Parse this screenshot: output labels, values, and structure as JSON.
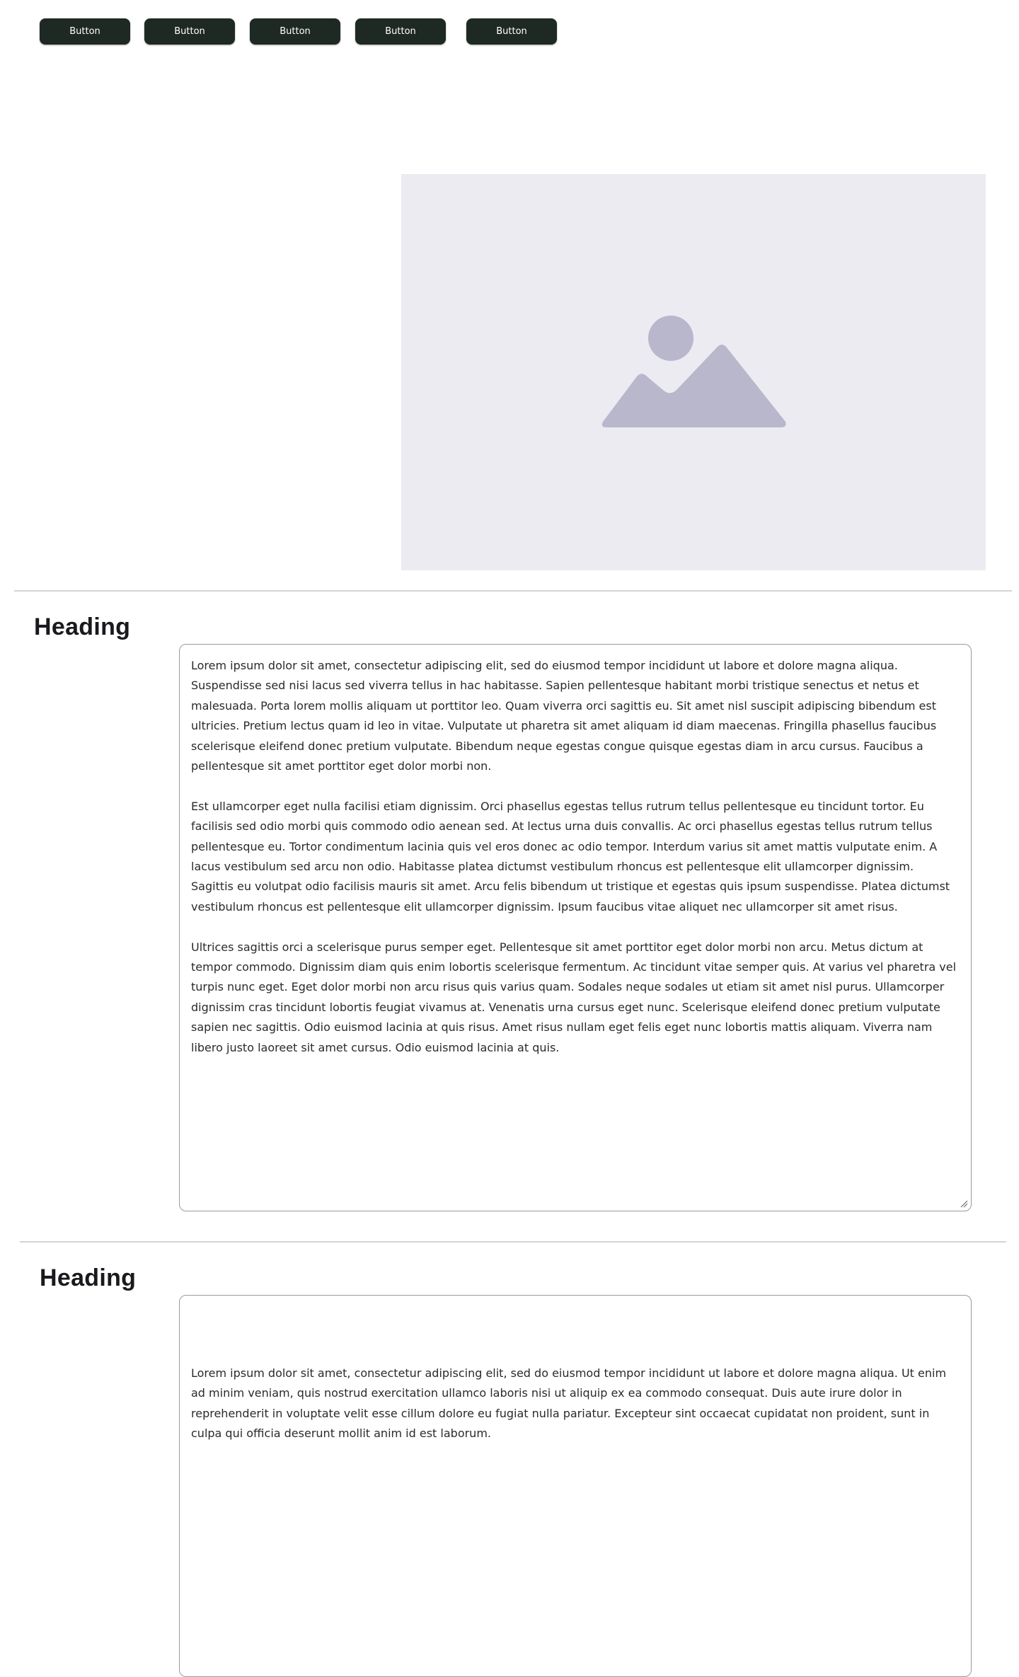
{
  "buttons": [
    {
      "label": "Button"
    },
    {
      "label": "Button"
    },
    {
      "label": "Button"
    },
    {
      "label": "Button"
    },
    {
      "label": "Button"
    }
  ],
  "image": {
    "icon": "image-placeholder-icon",
    "background_color": "#ecebf1",
    "icon_color": "#b8b7cc"
  },
  "sections": [
    {
      "heading": "Heading",
      "paragraphs": [
        "Lorem ipsum dolor sit amet, consectetur adipiscing elit, sed do eiusmod tempor incididunt ut labore et dolore magna aliqua. Suspendisse sed nisi lacus sed viverra tellus in hac habitasse. Sapien pellentesque habitant morbi tristique senectus et netus et malesuada. Porta lorem mollis aliquam ut porttitor leo. Quam viverra orci sagittis eu. Sit amet nisl suscipit adipiscing bibendum est ultricies. Pretium lectus quam id leo in vitae. Vulputate ut pharetra sit amet aliquam id diam maecenas. Fringilla phasellus faucibus scelerisque eleifend donec pretium vulputate. Bibendum neque egestas congue quisque egestas diam in arcu cursus. Faucibus a pellentesque sit amet porttitor eget dolor morbi non.",
        "Est ullamcorper eget nulla facilisi etiam dignissim. Orci phasellus egestas tellus rutrum tellus pellentesque eu tincidunt tortor. Eu facilisis sed odio morbi quis commodo odio aenean sed. At lectus urna duis convallis. Ac orci phasellus egestas tellus rutrum tellus pellentesque eu. Tortor condimentum lacinia quis vel eros donec ac odio tempor. Interdum varius sit amet mattis vulputate enim. A lacus vestibulum sed arcu non odio. Habitasse platea dictumst vestibulum rhoncus est pellentesque elit ullamcorper dignissim. Sagittis eu volutpat odio facilisis mauris sit amet. Arcu felis bibendum ut tristique et egestas quis ipsum suspendisse. Platea dictumst vestibulum rhoncus est pellentesque elit ullamcorper dignissim. Ipsum faucibus vitae aliquet nec ullamcorper sit amet risus.",
        "Ultrices sagittis orci a scelerisque purus semper eget. Pellentesque sit amet porttitor eget dolor morbi non arcu. Metus dictum at tempor commodo. Dignissim diam quis enim lobortis scelerisque fermentum. Ac tincidunt vitae semper quis. At varius vel pharetra vel turpis nunc eget. Eget dolor morbi non arcu risus quis varius quam. Sodales neque sodales ut etiam sit amet nisl purus. Ullamcorper dignissim cras tincidunt lobortis feugiat vivamus at. Venenatis urna cursus eget nunc. Scelerisque eleifend donec pretium vulputate sapien nec sagittis. Odio euismod lacinia at quis risus. Amet risus nullam eget felis eget nunc lobortis mattis aliquam. Viverra nam libero justo laoreet sit amet cursus. Odio euismod lacinia at quis."
      ]
    },
    {
      "heading": "Heading",
      "paragraphs": [
        "Lorem ipsum dolor sit amet, consectetur adipiscing elit, sed do eiusmod tempor incididunt ut labore et dolore magna aliqua. Ut enim ad minim veniam, quis nostrud exercitation ullamco laboris nisi ut aliquip ex ea commodo consequat. Duis aute irure dolor in reprehenderit in voluptate velit esse cillum dolore eu fugiat nulla pariatur. Excepteur sint occaecat cupidatat non proident, sunt in culpa qui officia deserunt mollit anim id est laborum."
      ]
    }
  ]
}
